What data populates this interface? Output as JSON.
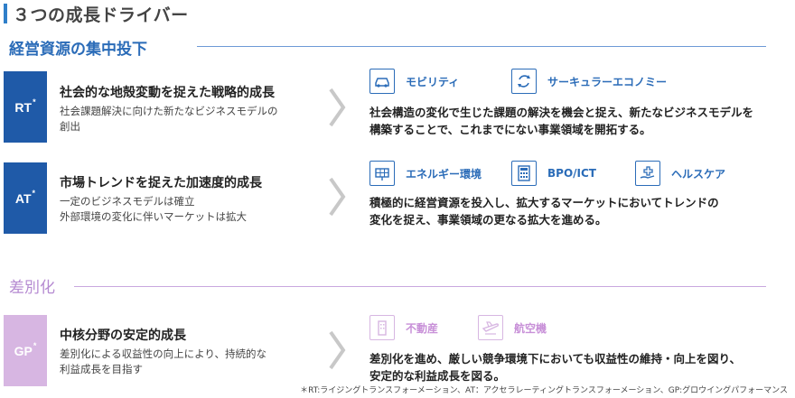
{
  "title": "３つの成長ドライバー",
  "sections": [
    {
      "label": "経営資源の集中投下"
    },
    {
      "label": "差別化"
    }
  ],
  "rows": [
    {
      "badge": "RT",
      "badge_mark": "*",
      "heading": "社会的な地殻変動を捉えた戦略的成長",
      "desc": [
        "社会課題解決に向けた新たなビジネスモデルの",
        "創出"
      ],
      "tags": [
        {
          "label": "モビリティ",
          "icon": "car-icon"
        },
        {
          "label": "サーキュラーエコノミー",
          "icon": "recycle-icon"
        }
      ],
      "body": [
        "社会構造の変化で生じた課題の解決を機会と捉え、新たなビジネスモデルを",
        "構築することで、これまでにない事業領域を開拓する。"
      ]
    },
    {
      "badge": "AT",
      "badge_mark": "*",
      "heading": "市場トレンドを捉えた加速度的成長",
      "desc": [
        "一定のビジネスモデルは確立",
        "外部環境の変化に伴いマーケットは拡大"
      ],
      "tags": [
        {
          "label": "エネルギー環境",
          "icon": "solar-panel-icon"
        },
        {
          "label": "BPO/ICT",
          "icon": "calculator-icon"
        },
        {
          "label": "ヘルスケア",
          "icon": "medical-hand-icon"
        }
      ],
      "body": [
        "積極的に経営資源を投入し、拡大するマーケットにおいてトレンドの",
        "変化を捉え、事業領域の更なる拡大を進める。"
      ]
    },
    {
      "badge": "GP",
      "badge_mark": "*",
      "heading": "中核分野の安定的成長",
      "desc": [
        "差別化による収益性の向上により、持続的な",
        "利益成長を目指す"
      ],
      "tags": [
        {
          "label": "不動産",
          "icon": "building-icon"
        },
        {
          "label": "航空機",
          "icon": "airplane-icon"
        }
      ],
      "body": [
        "差別化を進め、厳しい競争環境下においても収益性の維持・向上を図り、",
        "安定的な利益成長を図る。"
      ]
    }
  ],
  "footnote": "＊RT:ライジングトランスフォーメーション、AT：アクセラレーティングトランスフォーメーション、GP:グロウイングパフォーマンス",
  "colors": {
    "accent_blue": "#1f5aa8",
    "text_blue": "#2b6cb8",
    "accent_purple": "#d7b6e2",
    "text_purple": "#b58ad1"
  }
}
